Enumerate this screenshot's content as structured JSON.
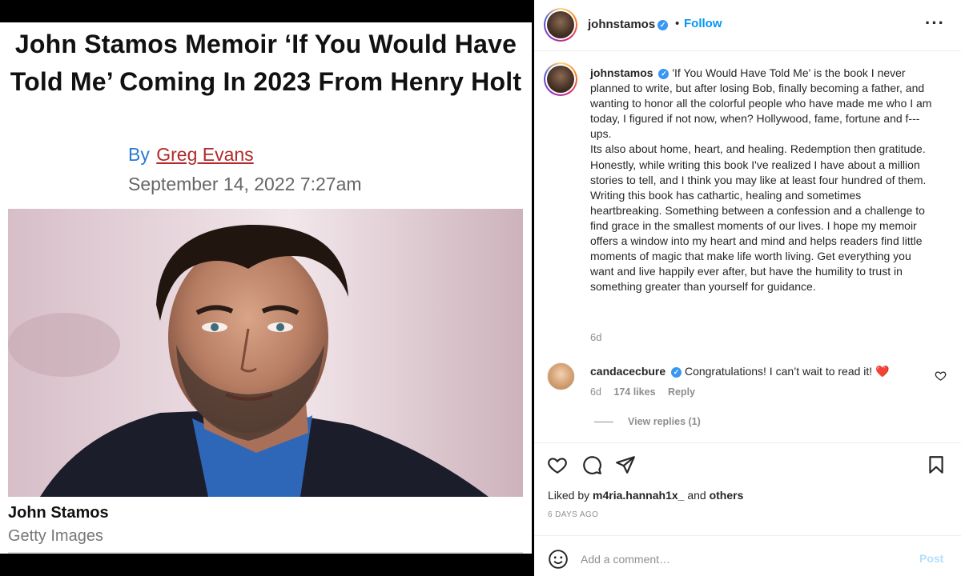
{
  "article": {
    "headline": "John Stamos Memoir ‘If You Would Have Told Me’ Coming In 2023 From Henry Holt",
    "byline_prefix": "By",
    "author": "Greg Evans",
    "date": "September 14, 2022 7:27am",
    "photo_caption": "John Stamos",
    "photo_credit": "Getty Images",
    "colors": {
      "byline": "#2b7bd1",
      "author_link": "#b22a2a"
    }
  },
  "instagram": {
    "header": {
      "username": "johnstamos",
      "separator": "•",
      "follow_label": "Follow",
      "more_icon": "more-horizontal-icon"
    },
    "caption": {
      "username": "johnstamos",
      "paragraphs": [
        "'If You Would Have Told Me' is the book I never planned to write, but after losing Bob, finally becoming a father, and wanting to honor all the colorful people who have made me who I am today, I figured if not now, when? Hollywood, fame, fortune and f---ups.",
        "Its also about home, heart, and healing. Redemption then gratitude. Honestly, while writing this book I've realized I have about a million stories to tell, and I think you may like at least four hundred of them.",
        "Writing this book has cathartic, healing and sometimes heartbreaking. Something between a confession and a challenge to find grace in the smallest moments of our lives. I hope my memoir offers a window into my heart and mind and helps readers find little moments of magic that make life worth living. Get everything you want and live happily ever after, but have the humility to trust in something greater than yourself for guidance."
      ],
      "time": "6d"
    },
    "comment": {
      "username": "candacecbure",
      "text": "Congratulations! I can’t wait to read it!",
      "emoji": "❤️",
      "time": "6d",
      "likes": "174 likes",
      "reply_label": "Reply",
      "view_replies": "View replies (1)"
    },
    "actions": {
      "icons": [
        "heart-icon",
        "comment-icon",
        "share-icon",
        "bookmark-icon"
      ]
    },
    "liked_by": {
      "prefix": "Liked by",
      "user": "m4ria.hannah1x_",
      "middle": "and",
      "others": "others"
    },
    "posted": "6 DAYS AGO",
    "add_comment": {
      "placeholder": "Add a comment…",
      "post_label": "Post"
    },
    "colors": {
      "link_blue": "#0095f6",
      "muted": "#8e8e8e",
      "post_disabled": "#b2dffc",
      "verified": "#3897f0"
    }
  }
}
